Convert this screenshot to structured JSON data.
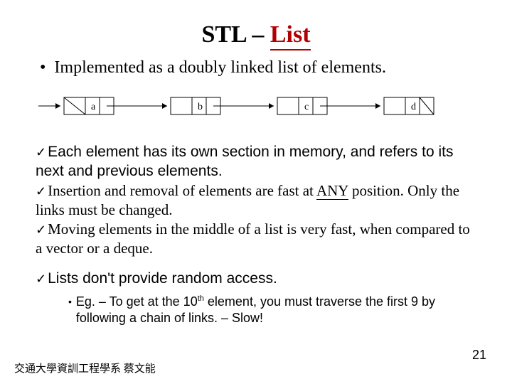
{
  "title": {
    "black": "STL – ",
    "red": "List"
  },
  "main_bullet": "Implemented as a doubly linked list of elements.",
  "diagram": {
    "labels": [
      "a",
      "b",
      "c",
      "d"
    ]
  },
  "checks": {
    "c1a": "Each",
    "c1b": " element has its own section in memory, and refers to its next and previous elements.",
    "c2a": "Insertion",
    "c2b": " and removal of elements are fast at ",
    "c2any": "ANY",
    "c2c": " position. Only the links must be changed.",
    "c3a": "Moving",
    "c3b": " elements in the middle of a list is very fast, when compared to a vector or a deque.",
    "c4a": "Lists",
    "c4b": " don't provide random access."
  },
  "sub": {
    "eg_a": "Eg. – To get at the 10",
    "eg_th": "th",
    "eg_b": " element, you must traverse the first 9 by following a chain of links. – Slow!"
  },
  "footer": "交通大學資訓工程學系 蔡文能",
  "page": "21"
}
